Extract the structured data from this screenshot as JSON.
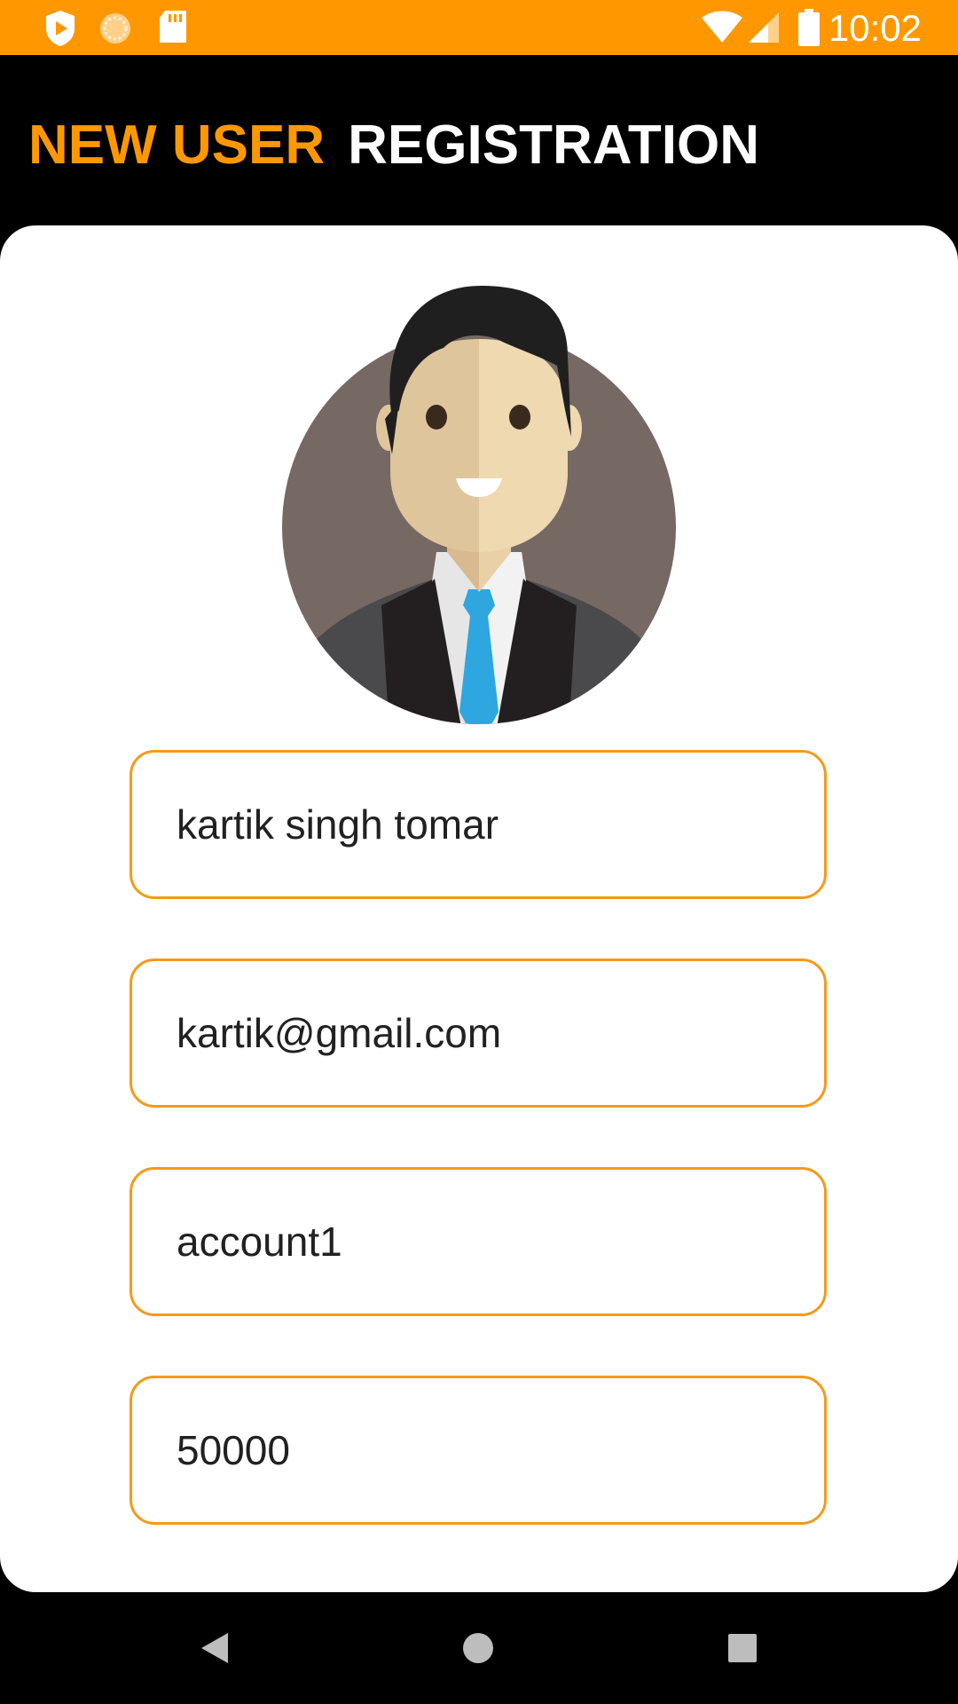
{
  "status_bar": {
    "time": "10:02",
    "background_color": "#FF9800",
    "left_icons": [
      "play-protect-icon",
      "sync-icon",
      "sd-card-icon"
    ],
    "right_icons": [
      "wifi-icon",
      "cell-signal-icon",
      "battery-icon"
    ]
  },
  "header": {
    "title_part1": "NEW USER",
    "title_part2": "REGISTRATION",
    "accent_color": "#FF9800"
  },
  "form": {
    "avatar": "user-avatar-icon",
    "fields": [
      {
        "name": "name",
        "value": "kartik singh tomar"
      },
      {
        "name": "email",
        "value": "kartik@gmail.com"
      },
      {
        "name": "account",
        "value": "account1"
      },
      {
        "name": "amount",
        "value": "50000"
      }
    ],
    "border_color": "#F59A1A"
  },
  "nav_bar": {
    "buttons": [
      "back-icon",
      "home-icon",
      "recents-icon"
    ]
  }
}
